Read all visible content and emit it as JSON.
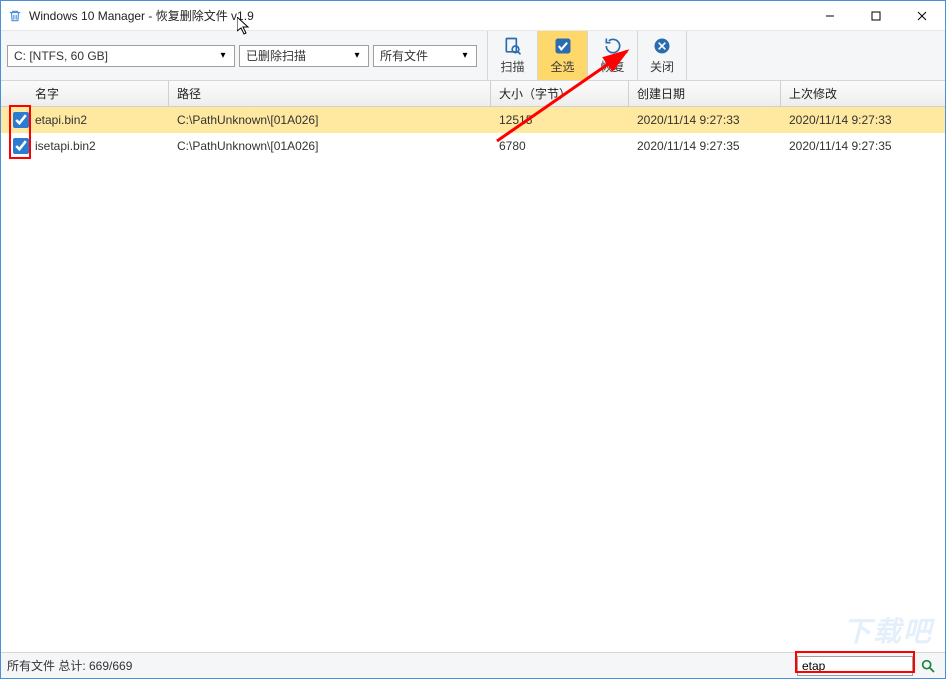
{
  "window": {
    "title": "Windows 10 Manager - 恢复删除文件 v1.9"
  },
  "toolbar": {
    "drive": "C: [NTFS, 60 GB]",
    "scan_mode": "已删除扫描",
    "file_type": "所有文件",
    "buttons": {
      "scan": "扫描",
      "select_all": "全选",
      "recover": "恢复",
      "close": "关闭"
    }
  },
  "columns": {
    "name": "名字",
    "path": "路径",
    "size": "大小（字节）",
    "created": "创建日期",
    "modified": "上次修改"
  },
  "rows": [
    {
      "checked": true,
      "selected": true,
      "name": "etapi.bin2",
      "path": "C:\\PathUnknown\\[01A026]",
      "size": "12515",
      "created": "2020/11/14 9:27:33",
      "modified": "2020/11/14 9:27:33"
    },
    {
      "checked": true,
      "selected": false,
      "name": "isetapi.bin2",
      "path": "C:\\PathUnknown\\[01A026]",
      "size": "6780",
      "created": "2020/11/14 9:27:35",
      "modified": "2020/11/14 9:27:35"
    }
  ],
  "status": {
    "text": "所有文件 总计: 669/669"
  },
  "search": {
    "value": "etap"
  },
  "watermark": "下载吧"
}
